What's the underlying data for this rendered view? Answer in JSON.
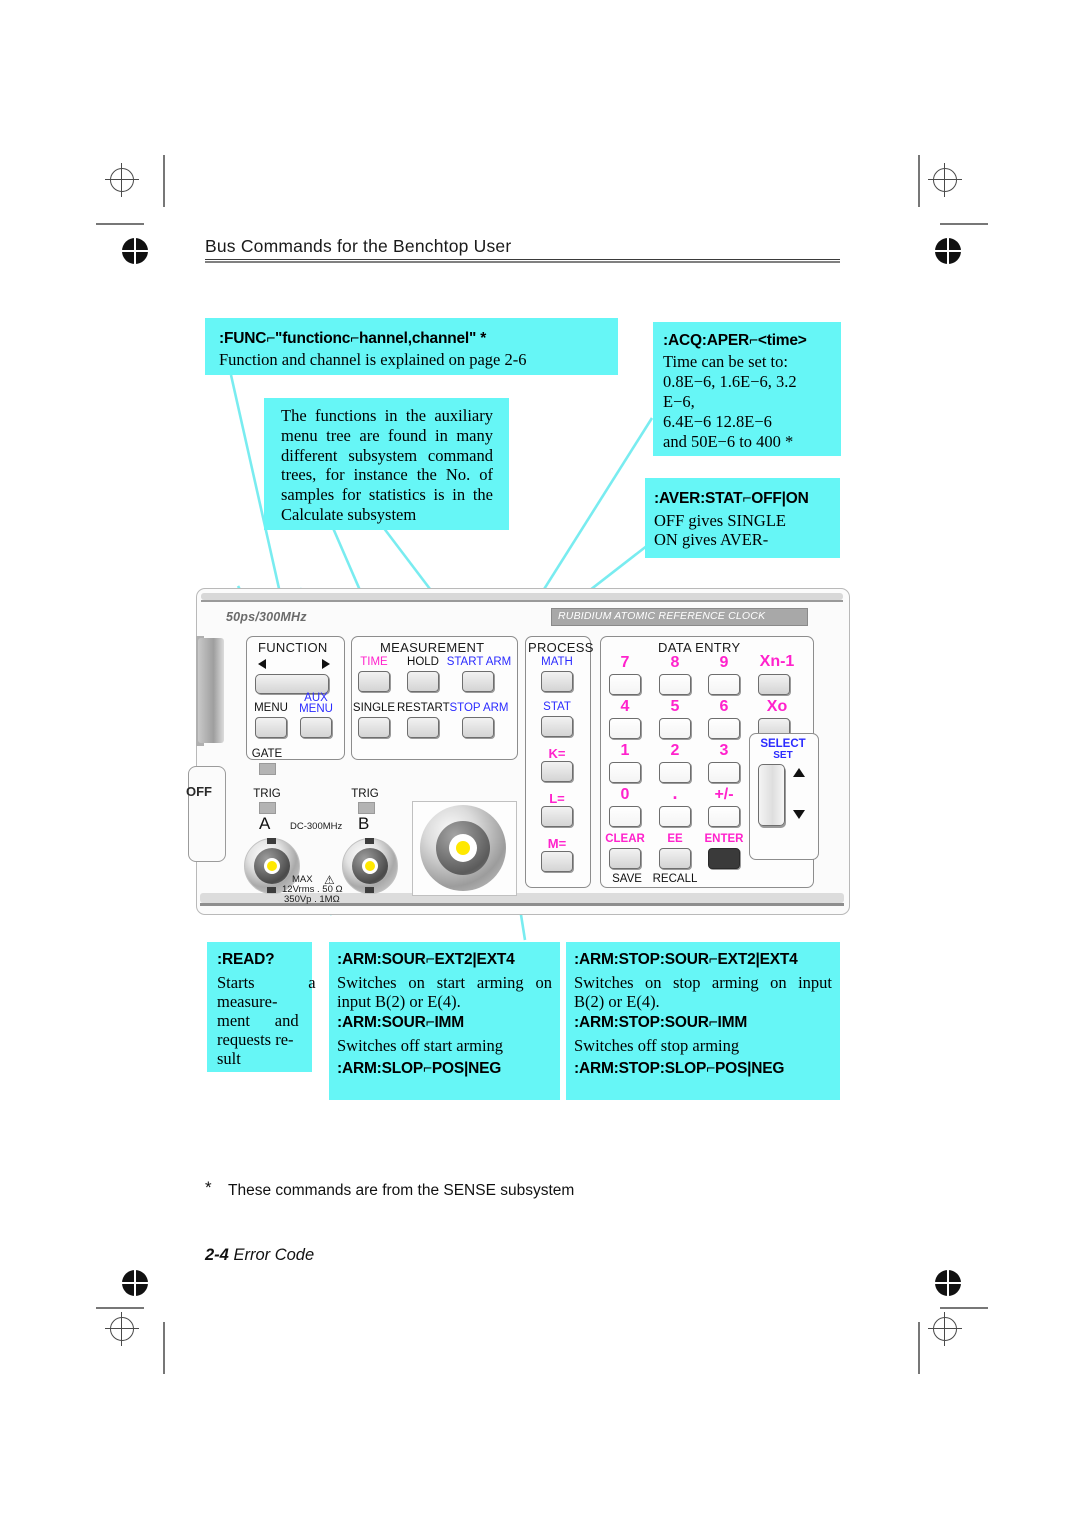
{
  "header": {
    "title": "Bus Commands for the Benchtop User"
  },
  "callouts": {
    "func": {
      "command": ":FUNC⌐\"functionc⌐hannel,channel\"   *",
      "body": "Function and channel is explained on page 2-6"
    },
    "aux": {
      "body": "The  functions in the auxiliary menu tree are found in many different subsystem command trees, for instance the No. of samples for statistics is in the Calculate subsystem"
    },
    "acq": {
      "command": ":ACQ:APER⌐<time>",
      "line1": "Time can be set to:",
      "line2": "0.8E−6,  1.6E−6,  3.2",
      "line3": "E−6,",
      "line4": "6.4E−6    12.8E−6",
      "line5": "and 50E−6 to 400     *"
    },
    "aver": {
      "command": ":AVER:STAT⌐OFF|ON",
      "line1": "OFF gives SINGLE",
      "line2": "ON      gives      AVER-"
    },
    "read": {
      "command": ":READ?",
      "body": "Starts a measure-ment and requests re-sult",
      "l1": "Starts             a",
      "l2": "measure-",
      "l3": "ment      and",
      "l4": "requests re-",
      "l5": "sult"
    },
    "arm_start": {
      "command1": ":ARM:SOUR⌐EXT2|EXT4",
      "text1a": "Switches on start arming on",
      "text1b": "input B(2) or E(4).",
      "command2": ":ARM:SOUR⌐IMM",
      "text2": "Switches off start arming",
      "command3": ":ARM:SLOP⌐POS|NEG"
    },
    "arm_stop": {
      "command1": ":ARM:STOP:SOUR⌐EXT2|EXT4",
      "text1a": "Switches on stop arming on input",
      "text1b": "B(2) or E(4).",
      "command2": ":ARM:STOP:SOUR⌐IMM",
      "text2": "Switches off stop arming",
      "command3": ":ARM:STOP:SLOP⌐POS|NEG"
    }
  },
  "instrument": {
    "model_label": "50ps/300MHz",
    "reference_label": "RUBIDIUM ATOMIC REFERENCE CLOCK",
    "power_off_label": "OFF",
    "groups": {
      "function": "FUNCTION",
      "measurement": "MEASUREMENT",
      "process": "PROCESS",
      "data_entry": "DATA ENTRY"
    },
    "function_keys": [
      {
        "label": "MENU",
        "color": "black"
      },
      {
        "label": "AUX",
        "label2": "MENU",
        "color": "blue"
      }
    ],
    "measurement_keys": [
      {
        "label": "TIME",
        "color": "magenta"
      },
      {
        "label": "HOLD",
        "color": "black"
      },
      {
        "label": "START ARM",
        "color": "blue"
      },
      {
        "label": "SINGLE",
        "color": "black"
      },
      {
        "label": "RESTART",
        "color": "black"
      },
      {
        "label": "STOP ARM",
        "color": "blue"
      }
    ],
    "process_keys": [
      {
        "label": "MATH",
        "color": "blue"
      },
      {
        "label": "STAT",
        "color": "blue"
      },
      {
        "label": "K=",
        "color": "magenta"
      },
      {
        "label": "L=",
        "color": "magenta"
      },
      {
        "label": "M=",
        "color": "magenta"
      }
    ],
    "data_entry_keys": [
      {
        "label": "7"
      },
      {
        "label": "8"
      },
      {
        "label": "9"
      },
      {
        "label": "Xn-1"
      },
      {
        "label": "4"
      },
      {
        "label": "5"
      },
      {
        "label": "6"
      },
      {
        "label": "Xo"
      },
      {
        "label": "1"
      },
      {
        "label": "2"
      },
      {
        "label": "3"
      },
      {
        "label": "0"
      },
      {
        "label": "."
      },
      {
        "label": "+/-"
      },
      {
        "label": "CLEAR"
      },
      {
        "label": "EE"
      },
      {
        "label": "ENTER"
      }
    ],
    "secondary_labels": [
      "SAVE",
      "RECALL"
    ],
    "select_label": "SELECT",
    "set_label": "SET",
    "gate_label": "GATE",
    "trig_label_a": "TRIG",
    "trig_label_b": "TRIG",
    "channel_a": "A",
    "channel_b": "B",
    "bandwidth": "DC-300MHz",
    "max_line1": "MAX",
    "max_line2": "12Vrms . 50 Ω",
    "max_line3": "350Vp . 1MΩ"
  },
  "footer": {
    "star": "*",
    "footnote": "These commands are from the SENSE subsystem",
    "folio_number": "2-4",
    "folio_title": "Error Code"
  },
  "colors": {
    "callout_bg": "#66f6f6",
    "leader_line": "#79ecf0",
    "magenta": "#ff22cc",
    "blue": "#2b2bff"
  }
}
